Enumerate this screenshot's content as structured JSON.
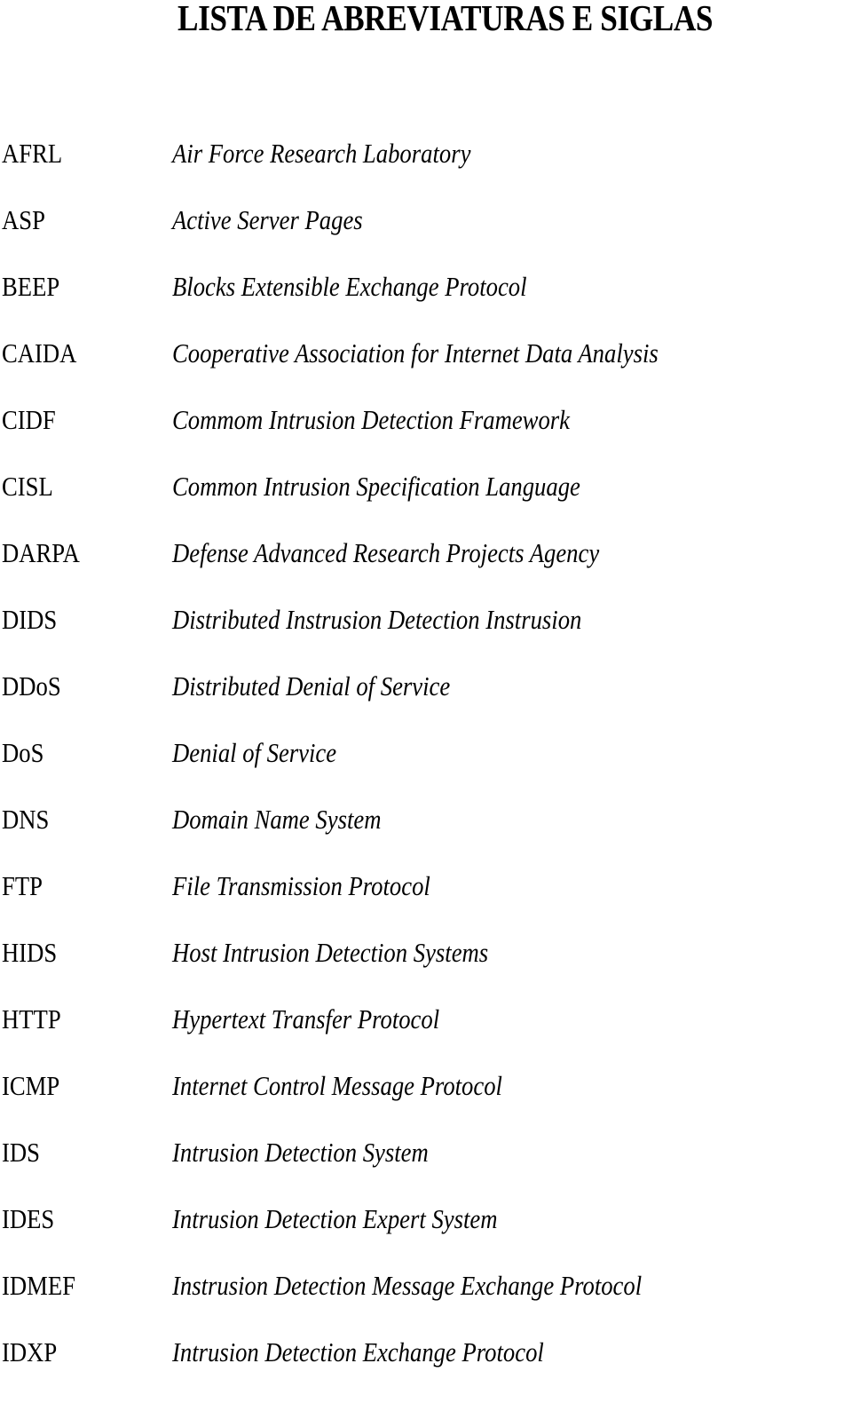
{
  "title": "LISTA DE ABREVIATURAS E SIGLAS",
  "entries": [
    {
      "abbr": "AFRL",
      "definition": "Air Force Research Laboratory"
    },
    {
      "abbr": "ASP",
      "definition": "Active Server Pages"
    },
    {
      "abbr": "BEEP",
      "definition": "Blocks Extensible Exchange Protocol"
    },
    {
      "abbr": "CAIDA",
      "definition": "Cooperative Association for Internet Data Analysis"
    },
    {
      "abbr": "CIDF",
      "definition": "Commom Intrusion Detection Framework"
    },
    {
      "abbr": "CISL",
      "definition": "Common Intrusion Specification Language"
    },
    {
      "abbr": "DARPA",
      "definition": "Defense Advanced Research Projects Agency"
    },
    {
      "abbr": "DIDS",
      "definition": "Distributed Instrusion Detection Instrusion"
    },
    {
      "abbr": "DDoS",
      "definition": "Distributed Denial of Service"
    },
    {
      "abbr": "DoS",
      "definition": "Denial of Service"
    },
    {
      "abbr": "DNS",
      "definition": "Domain Name System"
    },
    {
      "abbr": "FTP",
      "definition": "File Transmission Protocol"
    },
    {
      "abbr": "HIDS",
      "definition": "Host Intrusion Detection Systems"
    },
    {
      "abbr": "HTTP",
      "definition": "Hypertext Transfer Protocol"
    },
    {
      "abbr": "ICMP",
      "definition": "Internet Control Message Protocol"
    },
    {
      "abbr": "IDS",
      "definition": "Intrusion Detection System"
    },
    {
      "abbr": "IDES",
      "definition": "Intrusion Detection Expert System"
    },
    {
      "abbr": "IDMEF",
      "definition": "Instrusion Detection Message Exchange Protocol"
    },
    {
      "abbr": "IDXP",
      "definition": "Intrusion Detection Exchange Protocol"
    }
  ]
}
